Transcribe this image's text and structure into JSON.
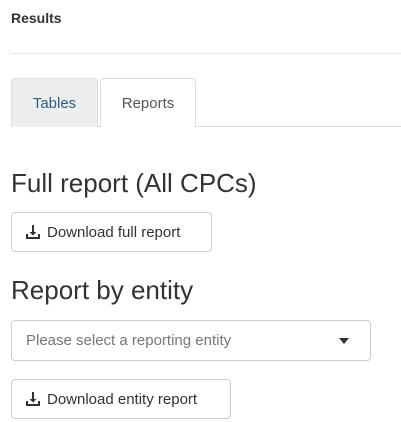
{
  "header": {
    "title": "Results"
  },
  "tabs": [
    {
      "label": "Tables",
      "active": false
    },
    {
      "label": "Reports",
      "active": true
    }
  ],
  "full_report": {
    "heading": "Full report (All CPCs)",
    "button_label": "Download full report",
    "icon": "download-icon"
  },
  "entity_report": {
    "heading": "Report by entity",
    "select_placeholder": "Please select a reporting entity",
    "select_icon": "chevron-down-icon",
    "button_label": "Download entity report",
    "icon": "download-icon"
  },
  "colors": {
    "active_tab_bg": "#ffffff",
    "inactive_tab_bg": "#eeeeee",
    "link_blue": "#2a5f8a",
    "border": "#cccccc"
  }
}
